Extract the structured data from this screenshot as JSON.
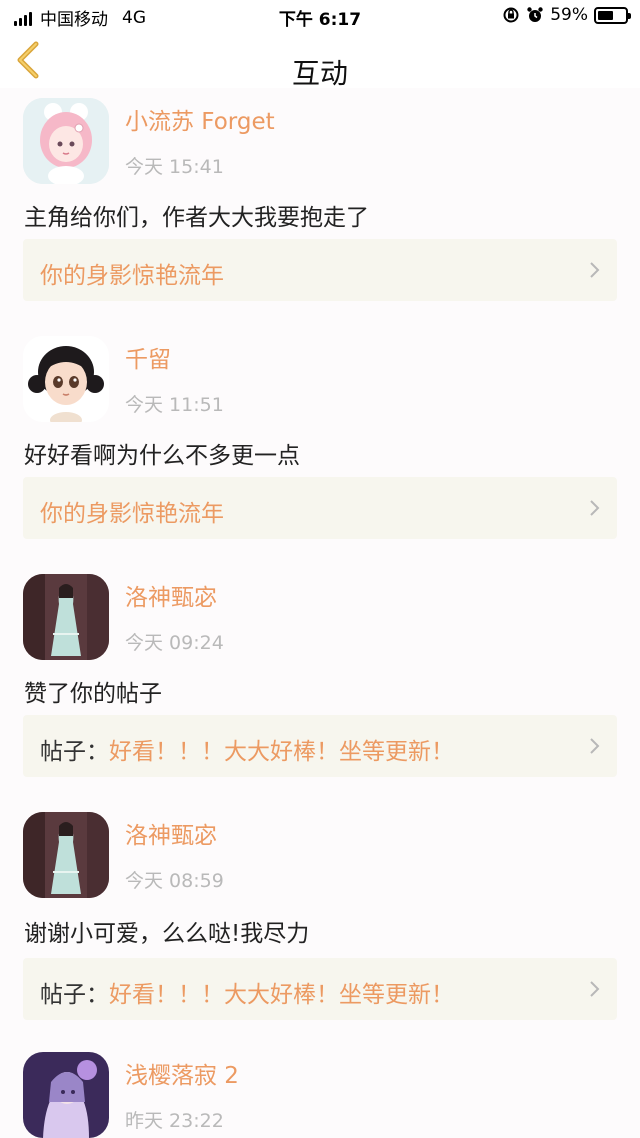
{
  "status": {
    "carrier": "中国移动",
    "network": "4G",
    "time": "下午 6:17",
    "battery": "59%",
    "battery_level": 0.59
  },
  "nav": {
    "title": "互动"
  },
  "colors": {
    "accent": "#ec9a62",
    "card_bg": "#f7f6ee",
    "time_gray": "#b9b9b9"
  },
  "items": [
    {
      "user": "小流苏 Forget",
      "time": "今天 15:41",
      "message": "主角给你们，作者大大我要抱走了",
      "ref_prefix": "",
      "ref_title": "你的身影惊艳流年",
      "avatar": "pink-hair-girl-avatar"
    },
    {
      "user": "千留",
      "time": "今天 11:51",
      "message": "好好看啊为什么不多更一点",
      "ref_prefix": "",
      "ref_title": "你的身影惊艳流年",
      "avatar": "black-hair-girl-avatar"
    },
    {
      "user": "洛神甄宓",
      "time": "今天 09:24",
      "message": "赞了你的帖子",
      "ref_prefix": "帖子：",
      "ref_title": "好看！！！大大好棒！坐等更新！",
      "avatar": "goddess-avatar"
    },
    {
      "user": "洛神甄宓",
      "time": "今天 08:59",
      "message": "谢谢小可爱，么么哒!我尽力",
      "ref_prefix": "帖子：",
      "ref_title": "好看！！！大大好棒！坐等更新！",
      "avatar": "goddess-avatar"
    },
    {
      "user": "浅樱落寂 2",
      "time": "昨天 23:22",
      "message": "",
      "ref_prefix": "",
      "ref_title": "",
      "avatar": "anime-purple-avatar"
    }
  ]
}
